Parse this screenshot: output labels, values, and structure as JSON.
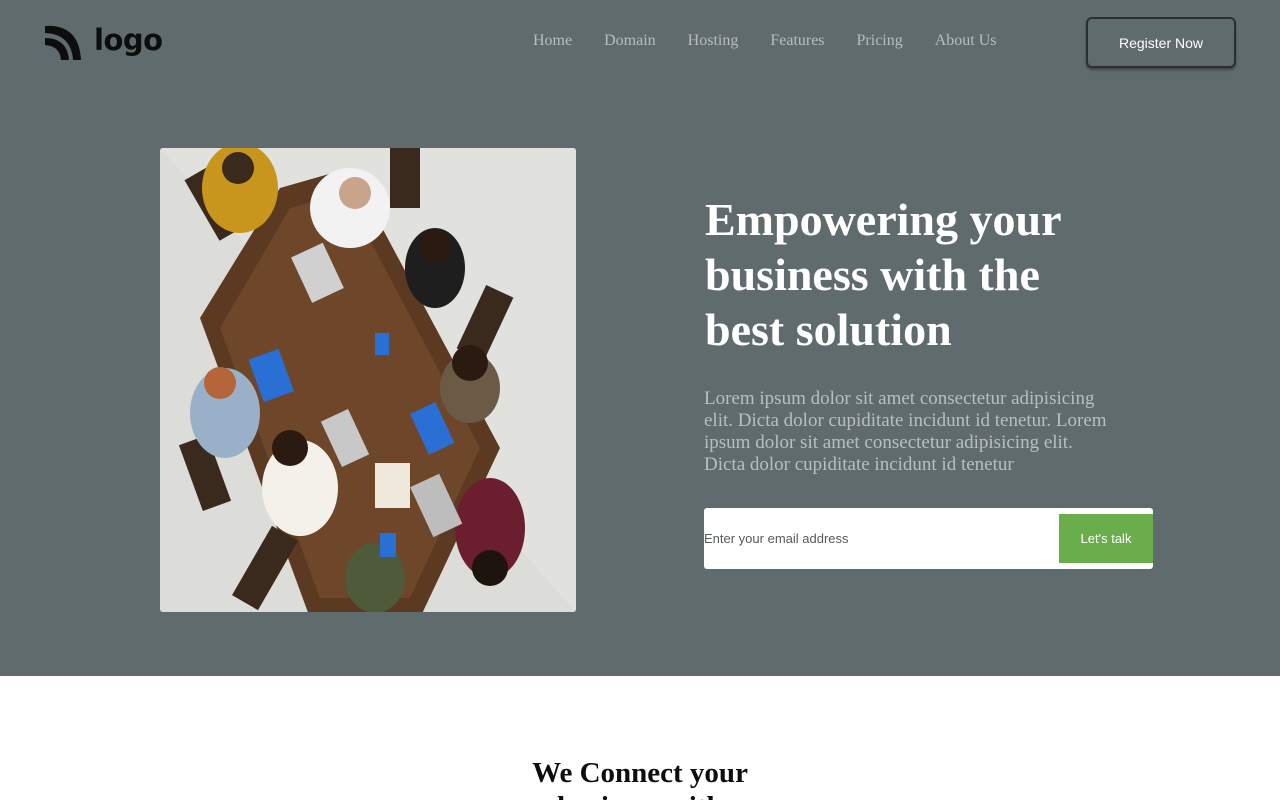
{
  "header": {
    "logo_text": "logo",
    "nav": [
      {
        "label": "Home"
      },
      {
        "label": "Domain"
      },
      {
        "label": "Hosting"
      },
      {
        "label": "Features"
      },
      {
        "label": "Pricing"
      },
      {
        "label": "About Us"
      }
    ],
    "register_label": "Register Now"
  },
  "hero": {
    "headline": "Empowering your business with the best solution",
    "description": "Lorem ipsum dolor sit amet consectetur adipisicing elit. Dicta dolor cupiditate incidunt id tenetur. Lorem ipsum dolor sit amet consectetur adipisicing elit. Dicta dolor cupiditate incidunt id tenetur",
    "email_placeholder": "Enter your email address",
    "cta_label": "Let's talk",
    "image_icon": "team-meeting-photo"
  },
  "section": {
    "title": "We Connect your business with"
  },
  "colors": {
    "hero_bg": "#606b6d",
    "accent_green": "#6aae4c",
    "nav_text": "#b7bdbe"
  }
}
